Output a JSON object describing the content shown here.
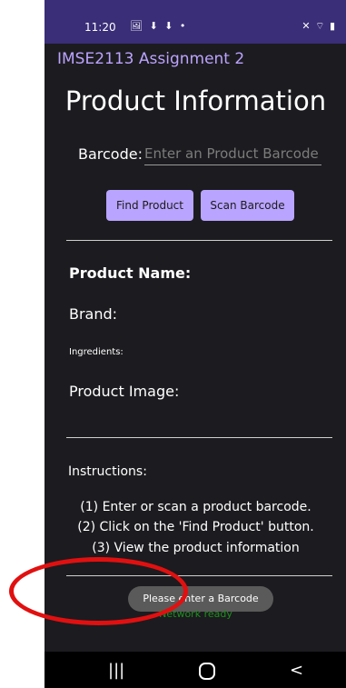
{
  "status_bar": {
    "time": "11:20",
    "left_icons": "🖼 ⬇ ⬇ •",
    "right_icons": "✕ ⌔ ▮"
  },
  "app_title": "IMSE2113 Assignment 2",
  "page_title": "Product Information",
  "barcode": {
    "label": "Barcode:",
    "placeholder": "Enter an Product Barcode",
    "value": ""
  },
  "buttons": {
    "find": "Find Product",
    "scan": "Scan Barcode"
  },
  "product": {
    "name_label": "Product Name:",
    "brand_label": "Brand:",
    "ingredients_label": "Ingredients:",
    "image_label": "Product Image:"
  },
  "instructions": {
    "title": "Instructions:",
    "steps": [
      "(1) Enter or scan a product barcode.",
      "(2) Click on the 'Find Product' button.",
      "(3) View the product information"
    ]
  },
  "toast": "Please enter a Barcode",
  "network_status": "Network ready",
  "nav": {
    "recent": "|||",
    "back": "<"
  },
  "colors": {
    "status_bar": "#3a2e78",
    "app_title": "#bba3ff",
    "button": "#b9a4ff",
    "network_status": "#1e8f1e",
    "annotation_ring": "#e11010"
  }
}
